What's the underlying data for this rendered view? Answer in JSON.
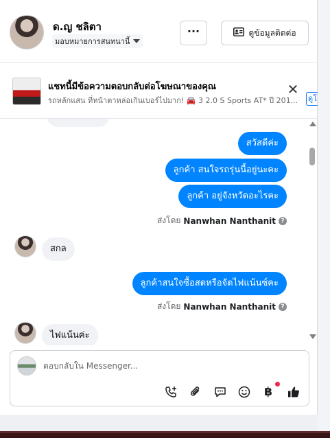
{
  "header": {
    "contact_name": "ด.ญ ชลิตา",
    "assign_label": "มอบหมายการสนทนานี้",
    "more_label": "···",
    "view_contact_label": "ดูข้อมูลติดต่อ"
  },
  "ad_banner": {
    "title": "แชทนี้มีข้อความตอบกลับต่อโฆษณาของคุณ",
    "subtitle": "รถหลักแสน ที่หน้าตาหล่อเกินเบอร์ไปมาก! 🚘 3 2.0 S Sports AT* ปี 201...",
    "view_label": "ดูโ",
    "close_label": "✕"
  },
  "messages": {
    "out1": "สวัสดีค่ะ",
    "out2": "ลูกค้า สนใจรถรุ่นนี้อยู่นะคะ",
    "out3": "ลูกค้า อยู่จังหวัดอะไรคะ",
    "sent_by_prefix": "ส่งโดย",
    "sent_by_name": "Nanwhan Nanthanit",
    "in1": "สกล",
    "out4": "ลูกค้าสนใจซื้อสดหรือจัดไฟแน้นซ์คะ",
    "in2": "ไฟแน้นค่ะ"
  },
  "composer": {
    "placeholder": "ตอบกลับใน Messenger..."
  },
  "icons": {
    "call": "phone-plus-icon",
    "attach": "paperclip-icon",
    "saved_replies": "chat-bubble-icon",
    "emoji": "emoji-icon",
    "payment": "baht-icon",
    "like": "thumbs-up-icon"
  },
  "colors": {
    "outgoing_bubble": "#0084ff",
    "incoming_bubble": "#f0f2f5",
    "accent": "#1877f2",
    "notification": "#f02849"
  }
}
